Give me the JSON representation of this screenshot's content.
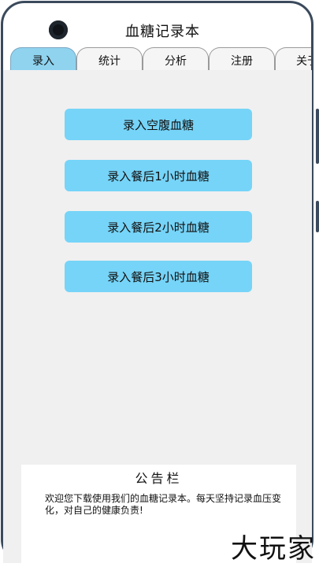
{
  "app": {
    "title": "血糖记录本"
  },
  "tabs": [
    {
      "label": "录入",
      "active": true
    },
    {
      "label": "统计",
      "active": false
    },
    {
      "label": "分析",
      "active": false
    },
    {
      "label": "注册",
      "active": false
    },
    {
      "label": "关于",
      "active": false
    }
  ],
  "actions": [
    {
      "label": "录入空腹血糖"
    },
    {
      "label": "录入餐后1小时血糖"
    },
    {
      "label": "录入餐后2小时血糖"
    },
    {
      "label": "录入餐后3小时血糖"
    }
  ],
  "notice": {
    "title": "公告栏",
    "text": "欢迎您下载使用我们的血糖记录本。每天坚持记录血压变化，对自己的健康负责!"
  },
  "watermark": "大玩家",
  "colors": {
    "accent": "#76d4f8",
    "active_tab": "#8fd3ef",
    "frame": "#3b4a5c"
  }
}
